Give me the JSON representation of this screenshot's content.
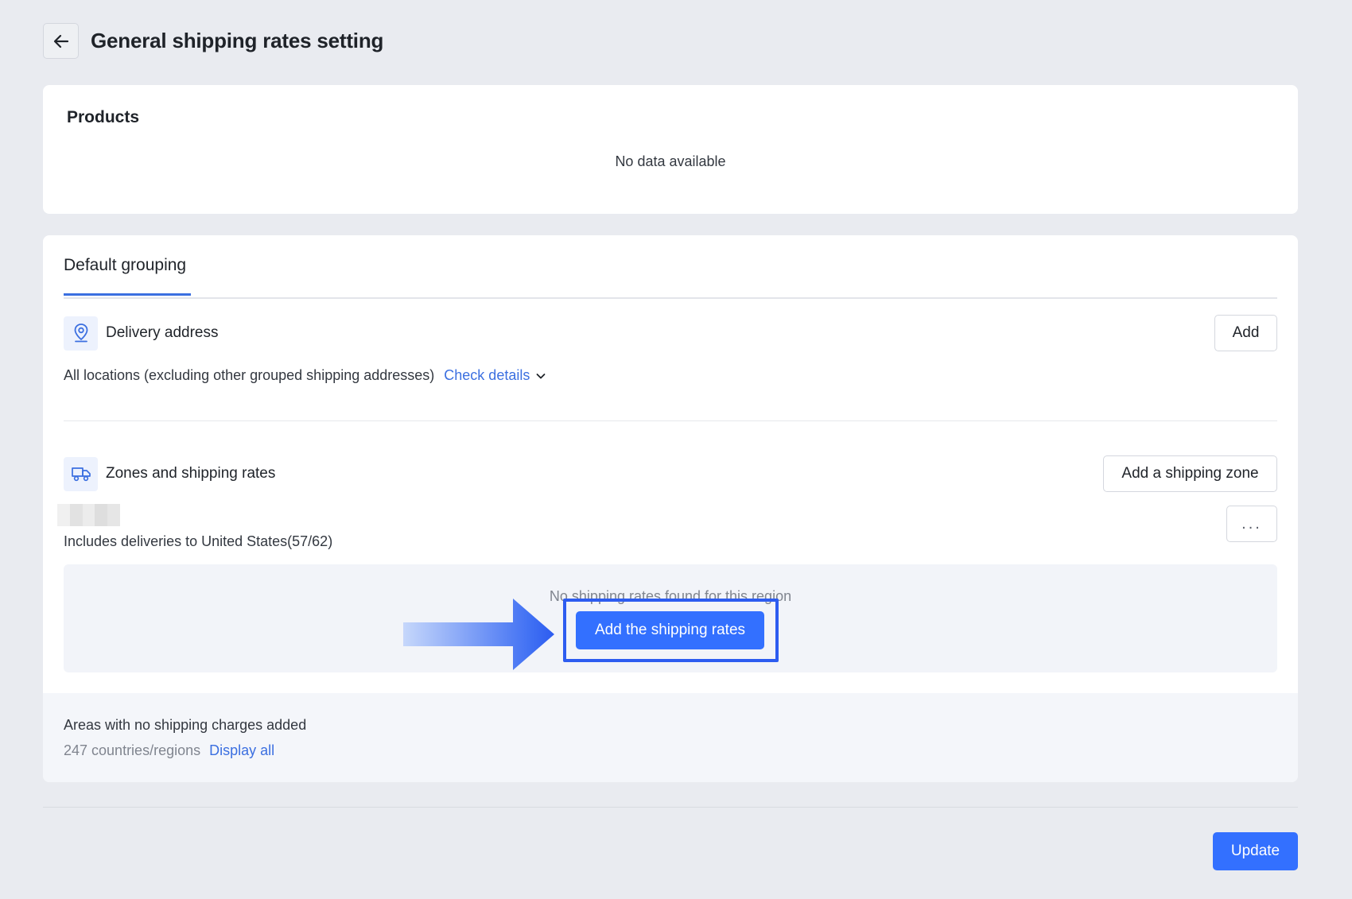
{
  "header": {
    "back_icon": "arrow-left-icon",
    "title": "General shipping rates setting"
  },
  "products": {
    "title": "Products",
    "empty_text": "No data available"
  },
  "grouping": {
    "tab_label": "Default grouping",
    "delivery": {
      "icon": "location-pin-icon",
      "label": "Delivery address",
      "add_label": "Add",
      "locations_text": "All locations (excluding other grouped shipping addresses)",
      "check_details_label": "Check details",
      "chevron_icon": "chevron-down-icon"
    },
    "zones": {
      "icon": "truck-icon",
      "label": "Zones and shipping rates",
      "add_zone_label": "Add a shipping zone",
      "zone_desc": "Includes deliveries to United States(57/62)",
      "more_label": "...",
      "empty_text": "No shipping rates found for this region",
      "add_rates_label": "Add the shipping rates"
    },
    "areas": {
      "title": "Areas with no shipping charges added",
      "count_text": "247 countries/regions",
      "display_all_label": "Display all"
    }
  },
  "footer": {
    "update_label": "Update"
  },
  "colors": {
    "primary": "#3370ff",
    "link": "#3b6fe0",
    "highlight": "#2d5cf0",
    "page_bg": "#e9ebf0"
  }
}
